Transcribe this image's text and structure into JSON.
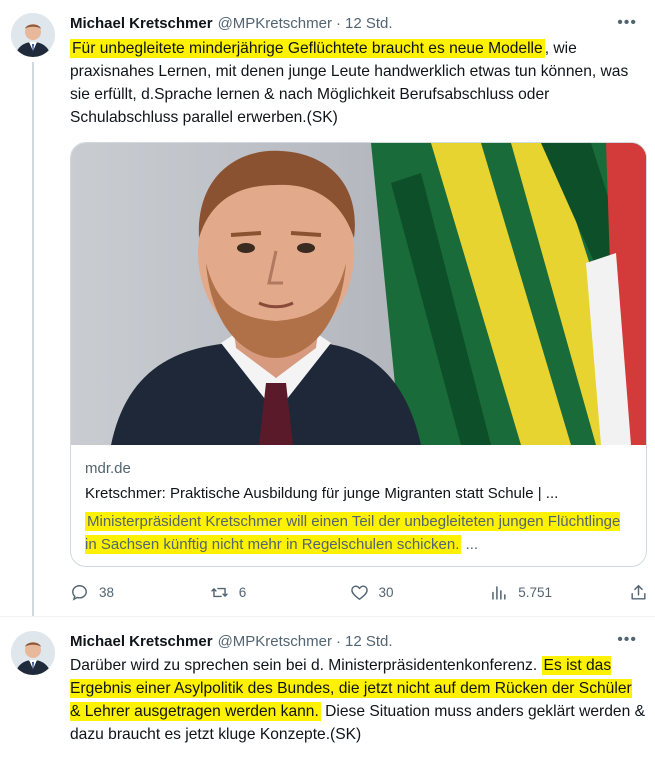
{
  "tweets": [
    {
      "author": {
        "name": "Michael Kretschmer",
        "handle": "@MPKretschmer",
        "time": "12 Std."
      },
      "text": {
        "highlighted_1": "Für unbegleitete minderjährige Geflüchtete braucht es neue Modelle",
        "plain_1": ", wie praxisnahes Lernen, mit denen junge Leute handwerklich etwas tun können, was sie erfüllt, d.Sprache lernen & nach Möglichkeit Berufsabschluss oder Schulabschluss parallel erwerben.(SK)"
      },
      "card": {
        "domain": "mdr.de",
        "title": "Kretschmer: Praktische Ausbildung für junge Migranten statt Schule | ...",
        "description": "Ministerpräsident Kretschmer will einen Teil der unbegleiteten jungen Flüchtlinge in Sachsen künftig nicht mehr in Regelschulen schicken.",
        "description_suffix": " ..."
      },
      "stats": {
        "replies": "38",
        "retweets": "6",
        "likes": "30",
        "views": "5.751"
      }
    },
    {
      "author": {
        "name": "Michael Kretschmer",
        "handle": "@MPKretschmer",
        "time": "12 Std."
      },
      "text": {
        "plain_1": "Darüber wird zu sprechen sein bei d. Ministerpräsidentenkonferenz.",
        "highlighted_1": "Es ist das Ergebnis einer Asylpolitik des Bundes, die jetzt nicht auf dem Rücken der Schüler & Lehrer ausgetragen werden kann.",
        "plain_2": " Diese Situation muss anders geklärt werden & dazu braucht es jetzt kluge Konzepte.(SK)"
      }
    }
  ],
  "more_icon": "more-horizontal-icon",
  "colors": {
    "highlight": "#fff200",
    "muted": "#536471",
    "border": "#cfd9de"
  }
}
